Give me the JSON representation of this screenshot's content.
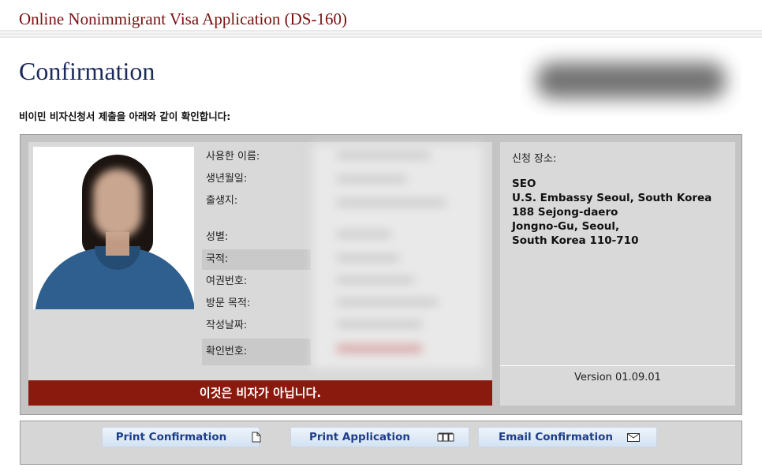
{
  "header": {
    "app_title": "Online Nonimmigrant Visa Application (DS-160)",
    "page_title": "Confirmation",
    "subtitle": "비이민 비자신청서 제출을 아래와 같이 확인합니다:"
  },
  "applicant": {
    "fields": [
      {
        "label": "사용한 이름:"
      },
      {
        "label": "생년월일:"
      },
      {
        "label": "출생지:"
      },
      {
        "label": "성별:"
      },
      {
        "label": "국적:"
      },
      {
        "label": "여권번호:"
      },
      {
        "label": "방문 목적:"
      },
      {
        "label": "작성날짜:"
      },
      {
        "label": "확인번호:"
      }
    ],
    "not_visa_banner": "이것은 비자가 아닙니다."
  },
  "location": {
    "label": "신청 장소:",
    "lines": [
      "SEO",
      "U.S. Embassy Seoul, South Korea",
      "188 Sejong-daero",
      "Jongno-Gu, Seoul,",
      "South Korea 110-710"
    ],
    "version": "Version 01.09.01"
  },
  "actions": {
    "print_confirmation": "Print Confirmation",
    "print_application": "Print Application",
    "email_confirmation": "Email Confirmation"
  },
  "colors": {
    "title_red": "#7a1010",
    "heading_navy": "#1c2a5a",
    "banner_red": "#8b1a0e",
    "button_text": "#1d3d8a"
  },
  "icons": {
    "print_confirmation": "document-icon",
    "print_application": "pages-icon",
    "email_confirmation": "envelope-icon"
  }
}
